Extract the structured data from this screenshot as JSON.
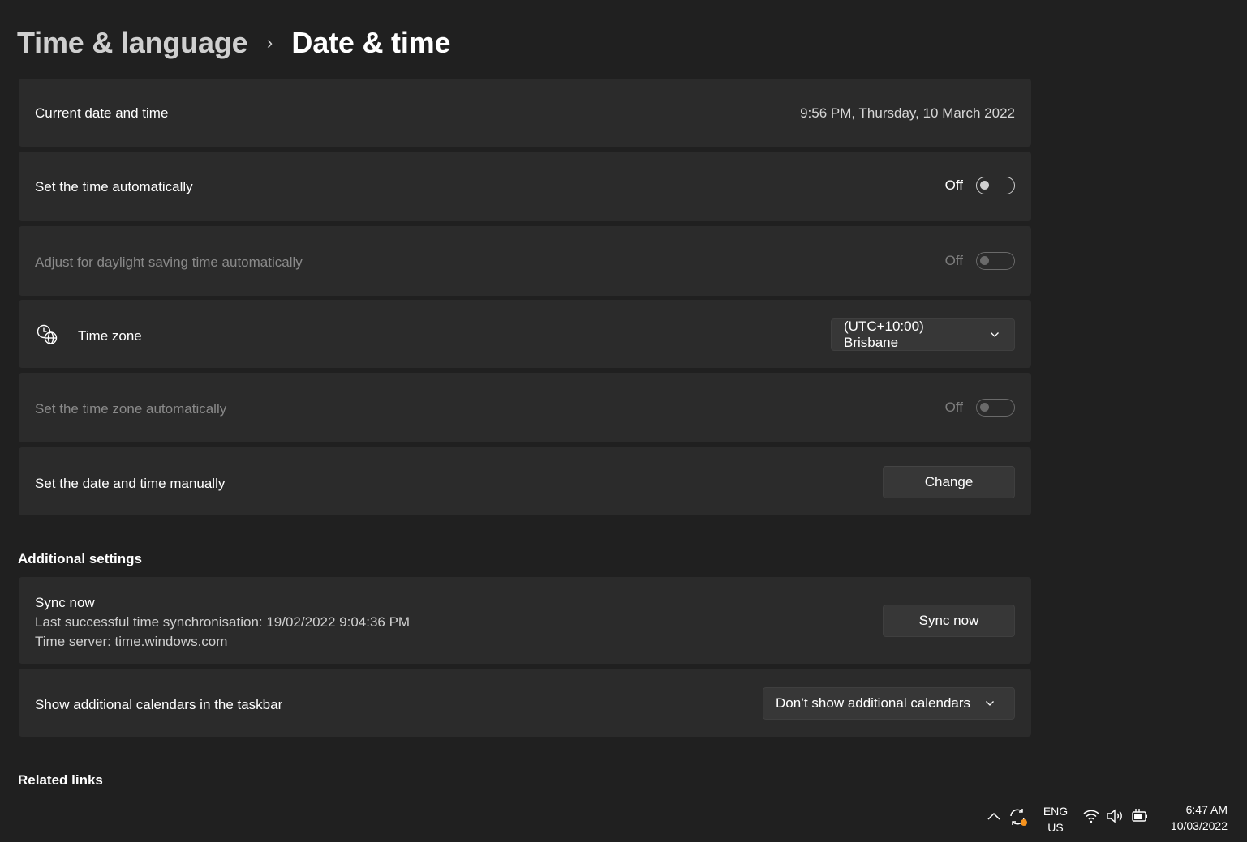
{
  "breadcrumb": {
    "parent": "Time & language",
    "separator": "›",
    "current": "Date & time"
  },
  "current_datetime": {
    "label": "Current date and time",
    "value": "9:56 PM, Thursday, 10 March 2022"
  },
  "set_time_auto": {
    "label": "Set the time automatically",
    "state": "Off"
  },
  "daylight_saving": {
    "label": "Adjust for daylight saving time automatically",
    "state": "Off"
  },
  "time_zone": {
    "label": "Time zone",
    "icon": "clock-globe-icon",
    "selected": "(UTC+10:00) Brisbane"
  },
  "time_zone_auto": {
    "label": "Set the time zone automatically",
    "state": "Off"
  },
  "manual_datetime": {
    "label": "Set the date and time manually",
    "button": "Change"
  },
  "additional_settings": {
    "title": "Additional settings",
    "sync": {
      "label": "Sync now",
      "last_sync": "Last successful time synchronisation: 19/02/2022 9:04:36 PM",
      "server": "Time server: time.windows.com",
      "button": "Sync now"
    },
    "calendars": {
      "label": "Show additional calendars in the taskbar",
      "selected": "Don’t show additional calendars"
    }
  },
  "related_links": {
    "title": "Related links"
  },
  "taskbar": {
    "lang_line1": "ENG",
    "lang_line2": "US",
    "time": "6:47 AM",
    "date": "10/03/2022",
    "notification_dot_color": "#f7931e"
  },
  "colors": {
    "background": "#202020",
    "card": "#2b2b2b",
    "button": "#373737"
  }
}
